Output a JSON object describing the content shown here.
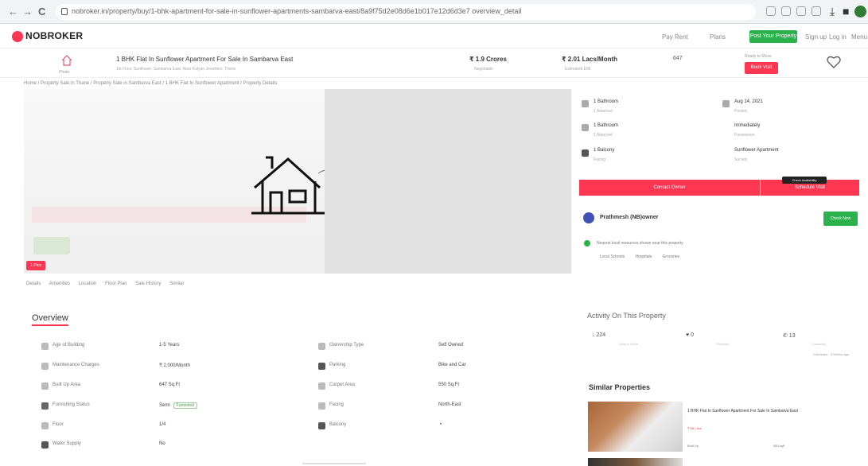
{
  "browser": {
    "back": "←",
    "forward": "→",
    "reload": "C",
    "url": "nobroker.in/property/buy/1-bhk-apartment-for-sale-in-sunflower-apartments-sambarva-east/8a9f75d2e08d6e1b017e12d6d3e7 overview_detail"
  },
  "header": {
    "logo": "NOBROKER",
    "links": [
      "Pay Rent",
      "Plans",
      "Post Your Property",
      "Sign up",
      "Log in",
      "Menu"
    ],
    "post_button": "Post Your Property"
  },
  "property": {
    "icon_label": "Photo",
    "title": "1 BHK Flat In Sunflower Apartment For Sale In Sambarva East",
    "subtitle": "1st Floor, Sunflower, Sambarva East, Near Kalyan Jewellers, Thane",
    "price": "₹ 1.9 Crores",
    "price_sub": "Negotiable",
    "emi": "₹ 2.01 Lacs/Month",
    "emi_sub": "Estimated EMI",
    "area": "647",
    "contact_label": "Ready to Move",
    "contact_button": "Book Visit"
  },
  "breadcrumb": "Home / Property Sale in Thane / Property Sale in Sambarva East / 1 BHK Flat In Sunflower Apartment / Property Details",
  "gallery": {
    "photo_badge": "1 Pics"
  },
  "amenity_tabs": [
    "Details",
    "Amenities",
    "Location",
    "Floor Plan",
    "Sale History",
    "Similar"
  ],
  "overview": {
    "title": "Overview",
    "rows": [
      {
        "l1": "Age of Building",
        "v1": "1-5 Years",
        "l2": "Ownership Type",
        "v2": "Self Owned"
      },
      {
        "l1": "Maintenance Charges",
        "v1": "₹ 2,000/Month",
        "l2": "Parking",
        "v2": "Bike and Car"
      },
      {
        "l1": "Built Up Area",
        "v1": "647 Sq.Ft",
        "l2": "Carpet Area",
        "v2": "550 Sq.Ft"
      },
      {
        "l1": "Furnishing Status",
        "v1": "Semi",
        "chip": "Furnished",
        "l2": "Facing",
        "v2": "North-East"
      },
      {
        "l1": "Floor",
        "v1": "1/4",
        "l2": "Balcony",
        "v2": "•"
      },
      {
        "l1": "Water Supply",
        "v1": "No",
        "l2": "",
        "v2": ""
      }
    ]
  },
  "right_panel": {
    "items": [
      {
        "val": "1 Bathroom",
        "sub": "1 Attached"
      },
      {
        "val": "Aug 14, 2021",
        "sub": "Posted"
      },
      {
        "val": "1 Bathroom",
        "sub": "1 Attached"
      },
      {
        "val": "Immediately",
        "sub": "Possession"
      },
      {
        "val": "1 Balcony",
        "sub": "Facing"
      },
      {
        "val": "Sunflower Apartment",
        "sub": "Society"
      }
    ],
    "bar_left": "Contact Owner",
    "bar_right": "Schedule Visit",
    "tooltip": "Check Availability",
    "owner_name": "Prathmesh (NB)owner",
    "chat_button": "Check Now",
    "note": "Nearest local resources shown near this property",
    "tags": [
      "Local Schools",
      "Hospitals",
      "Groceries"
    ]
  },
  "activity": {
    "title": "Activity On This Property",
    "stats": [
      {
        "val": "↓ 224",
        "lbl": "Unique Views"
      },
      {
        "val": "♥ 0",
        "lbl": "Shortlists"
      },
      {
        "val": "✆ 13",
        "lbl": "Contacted"
      }
    ],
    "more": "Contacted · 3 Weeks ago"
  },
  "similar": {
    "title": "Similar Properties",
    "item_title": "1 BHK Flat In Sunflower Apartment For Sale In Sambarva East",
    "item_sub": "₹ 55 Lacs",
    "meta_left": "Built Up",
    "meta_right": "550 sqft"
  }
}
